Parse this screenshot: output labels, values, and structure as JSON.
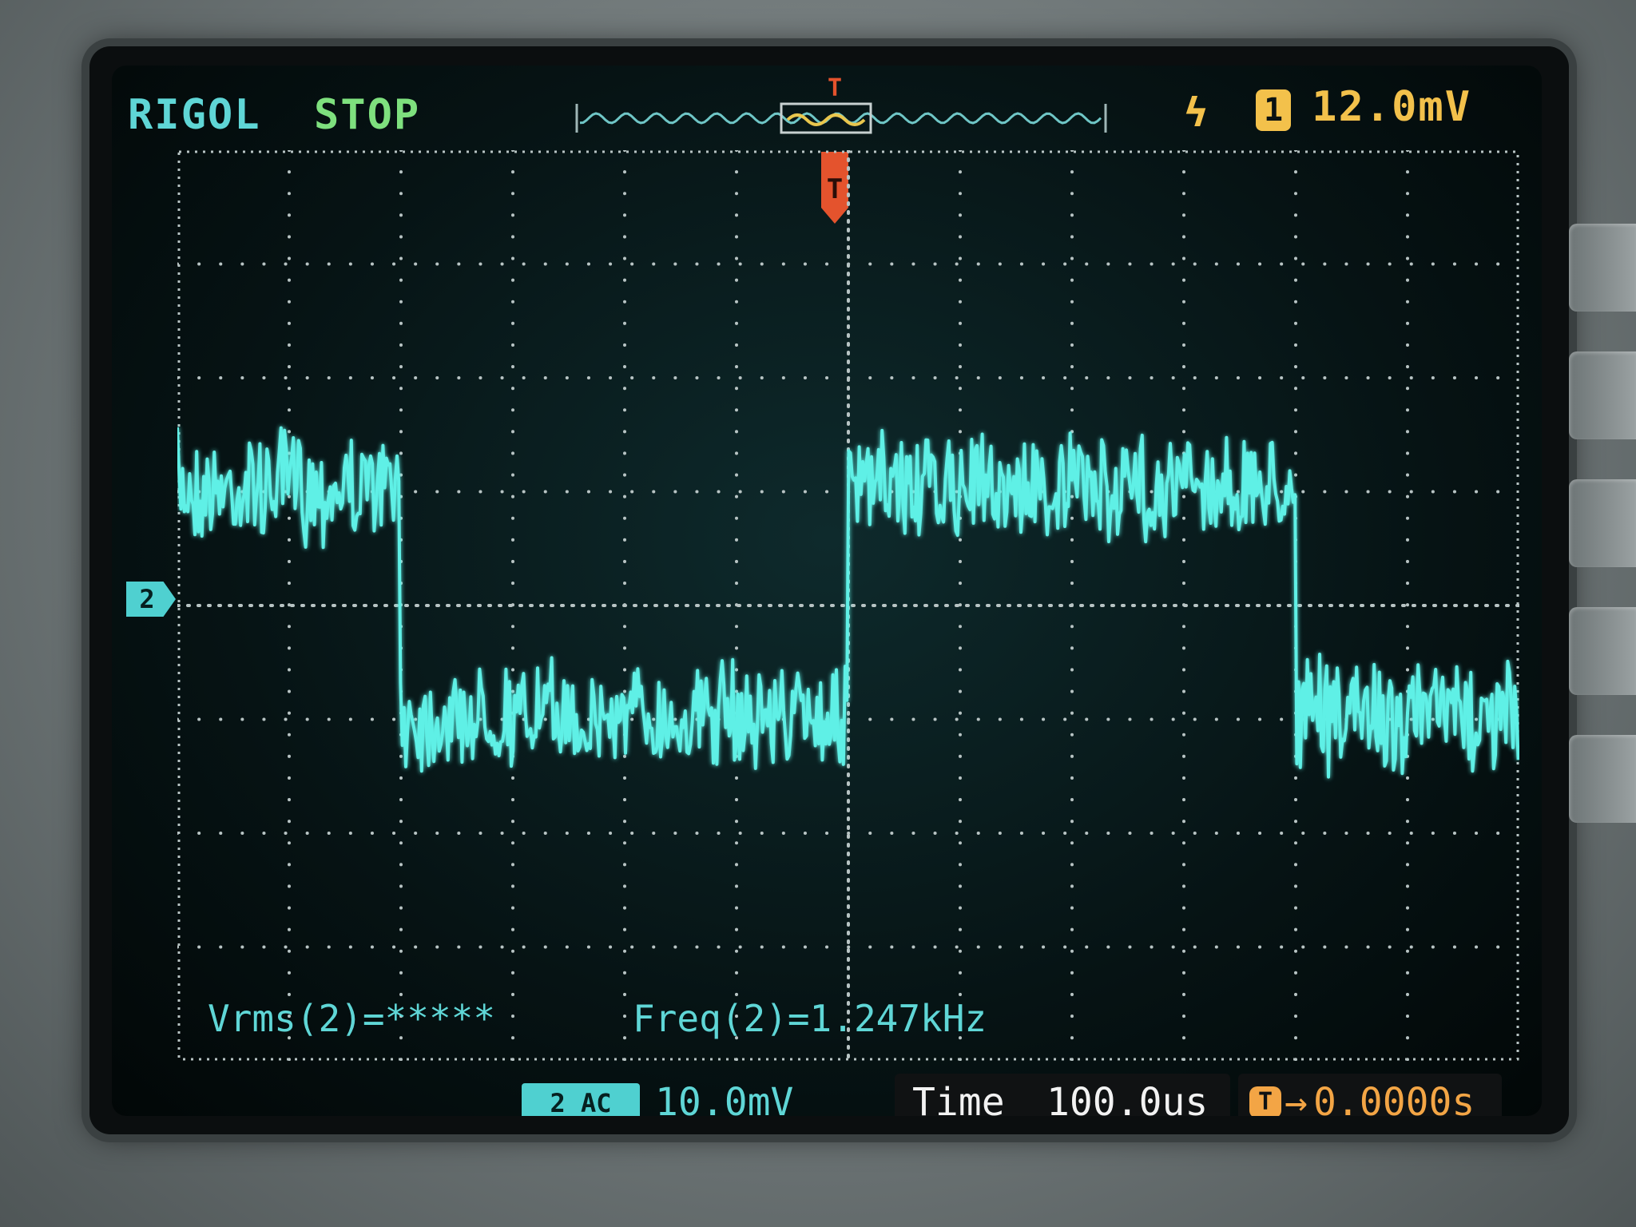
{
  "top_bar": {
    "brand": "RIGOL",
    "run_state": "STOP",
    "trigger_channel": "1",
    "trigger_level": "12.0mV",
    "edge_icon": "rising-edge-icon"
  },
  "channel_marker": "2",
  "measurements": {
    "vrms": "Vrms(2)=*****",
    "freq": "Freq(2)=1.247kHz"
  },
  "bottom_bar": {
    "ch2_coupling_badge": "2 AC",
    "ch2_scale": "10.0mV",
    "time_label": "Time",
    "time_value": "100.0us",
    "trigger_offset_icon": "T",
    "trigger_offset_arrow": "→",
    "trigger_offset_value": "0.0000s"
  },
  "trace": {
    "color": "#5ff0e6",
    "frequency": 1.247,
    "frequency_unit": "kHz",
    "volts_per_div": 10,
    "time_per_div": 100
  },
  "colors": {
    "brand": "#5fd6d6",
    "run_state": "#7ee07e",
    "trigger": "#f3c14b",
    "trigger_marker": "#e4532d",
    "grid": "#b8c4c4"
  }
}
